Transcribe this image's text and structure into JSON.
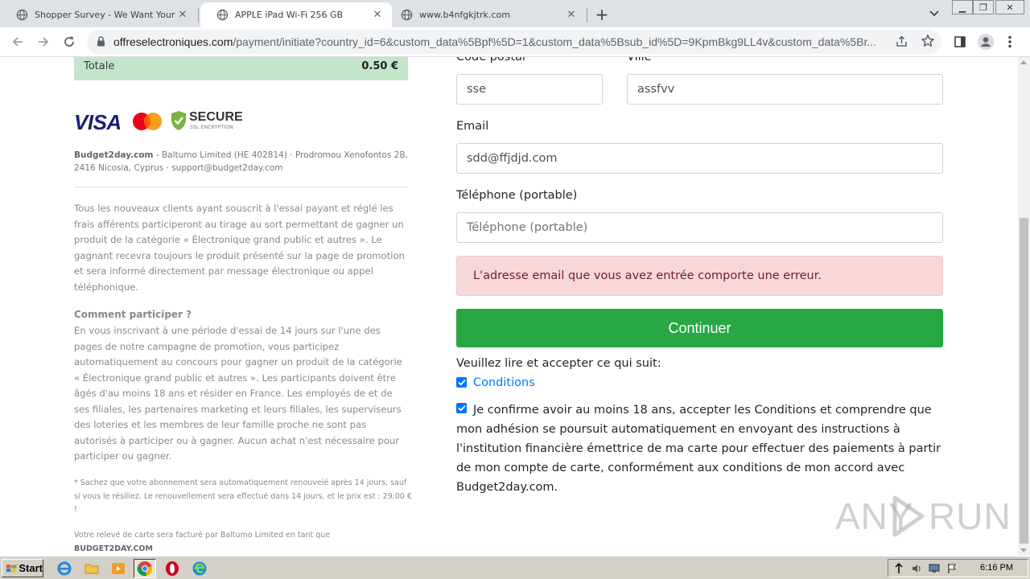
{
  "browser": {
    "tabs": [
      {
        "title": "Shopper Survey - We Want Your Op",
        "active": false
      },
      {
        "title": "APPLE iPad Wi-Fi 256 GB",
        "active": true
      },
      {
        "title": "www.b4nfgkjtrk.com",
        "active": false
      }
    ],
    "url_host": "offreselectroniques.com",
    "url_path": "/payment/initiate?country_id=6&custom_data%5Bpf%5D=1&custom_data%5Bsub_id%5D=9KpmBkg9LL4v&custom_data%5Br..."
  },
  "summary": {
    "total_label": "Totale",
    "total_amount": "0.50 €"
  },
  "badges": {
    "visa": "VISA",
    "secure": "SECURE",
    "secure_sub": "SSL ENCRYPTION"
  },
  "company": {
    "name": "Budget2day.com",
    "details": " - Baltumo Limited (HE 402814) · Prodromou Xenofontos 2B, 2416 Nicosia, Cyprus · support@budget2day.com"
  },
  "terms": {
    "intro": "Tous les nouveaux clients ayant souscrit à l'essai payant et réglé les frais afférents participeront au tirage au sort permettant de gagner un produit de la catégorie « Électronique grand public et autres ». Le gagnant recevra toujours le produit présenté sur la page de promotion et sera informé directement par message électronique ou appel téléphonique.",
    "how_title": "Comment participer ?",
    "how_text": "En vous inscrivant à une période d'essai de 14 jours sur l'une des pages de notre campagne de promotion, vous participez automatiquement au concours pour gagner un produit de la catégorie « Électronique grand public et autres ». Les participants doivent être âgés d'au moins 18 ans et résider en France. Les employés de et de ses filiales, les partenaires marketing et leurs filiales, les superviseurs des loteries et les membres de leur famille proche ne sont pas autorisés à participer ou à gagner. Aucun achat n'est nécessaire pour participer ou gagner.",
    "renewal": "* Sachez que votre abonnement sera automatiquement renouvelé après 14 jours, sauf si vous le résiliez. Le renouvellement sera effectué dans 14 jours, et le prix est : 29.00 € !",
    "billing": "Votre relevé de carte sera facturé par Baltumo Limited en tant que",
    "billing_name": "BUDGET2DAY.COM"
  },
  "form": {
    "postal_label": "Code postal",
    "postal_value": "sse",
    "city_label": "Ville",
    "city_value": "assfvv",
    "email_label": "Email",
    "email_value": "sdd@ffjdjd.com",
    "phone_label": "Téléphone (portable)",
    "phone_placeholder": "Téléphone (portable)",
    "error": "L'adresse email que vous avez entrée comporte une erreur.",
    "submit": "Continuer",
    "accept_label": "Veuillez lire et accepter ce qui suit:",
    "conditions_link": "Conditions",
    "confirm_text": "Je confirme avoir au moins 18 ans, accepter les Conditions et comprendre que mon adhésion se poursuit automatiquement en envoyant des instructions à l'institution financière émettrice de ma carte pour effectuer des paiements à partir de mon compte de carte, conformément aux conditions de mon accord avec Budget2day.com."
  },
  "watermark": {
    "left": "ANY",
    "right": "RUN"
  },
  "taskbar": {
    "start": "Start",
    "clock": "6:16 PM"
  },
  "colors": {
    "accent_green": "#28a745",
    "alert_bg": "#f8d7da",
    "alert_text": "#721c24",
    "link_blue": "#007bff",
    "total_bg": "#c3e6cb"
  }
}
